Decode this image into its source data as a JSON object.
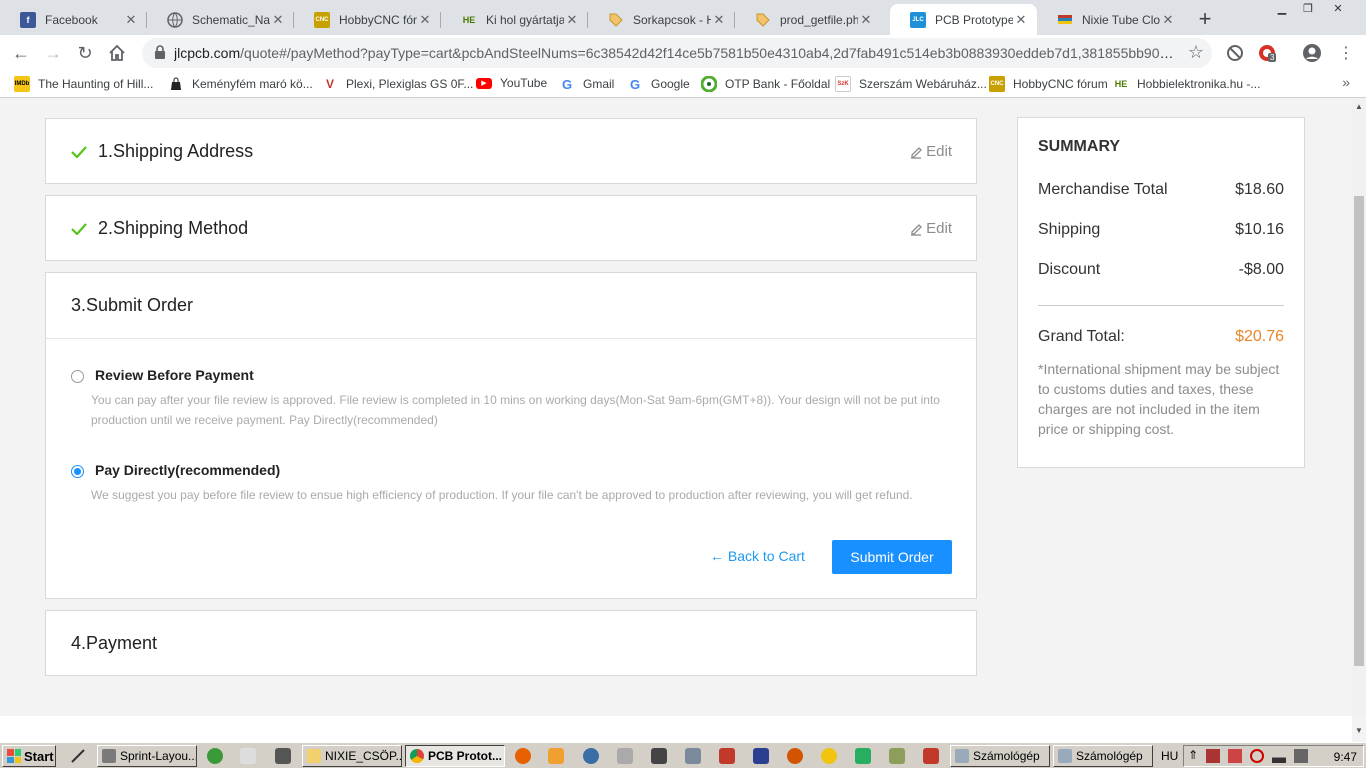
{
  "browser": {
    "tabs": [
      {
        "title": "Facebook",
        "icon": "facebook-icon",
        "color": "#3b5998",
        "glyph": "f"
      },
      {
        "title": "Schematic_Nano",
        "icon": "globe-icon",
        "color": "#5f6368",
        "glyph": ""
      },
      {
        "title": "HobbyCNC fórum",
        "icon": "cnc-icon",
        "color": "#c8a000",
        "glyph": "CNC"
      },
      {
        "title": "Ki hol gyártatja a",
        "icon": "he-icon",
        "color": "#4a7a00",
        "glyph": "HE"
      },
      {
        "title": "Sorkapcsok - HE",
        "icon": "tag-icon",
        "color": "#e8b04a",
        "glyph": ""
      },
      {
        "title": "prod_getfile.php",
        "icon": "tag-icon",
        "color": "#e8b04a",
        "glyph": ""
      },
      {
        "title": "PCB Prototype &",
        "icon": "jlc-icon",
        "color": "#1e90d8",
        "glyph": "JLC"
      },
      {
        "title": "Nixie Tube Clock",
        "icon": "tube-icon",
        "color": "#333333",
        "glyph": ""
      }
    ],
    "url_host": "jlcpcb.com",
    "url_rest": "/quote#/payMethod?payType=cart&pcbAndSteelNums=6c38542d42f14ce5b7581b50e4310ab4,2d7fab491c514eb3b0883930eddeb7d1,381855bb90b...",
    "extension_badge": "3"
  },
  "bookmarks": [
    {
      "label": "The Haunting of Hill...",
      "icon": "imdb-icon",
      "color": "#f5c518",
      "glyph": "IMDb"
    },
    {
      "label": "Keményfém maró kö...",
      "icon": "bag-icon",
      "color": "#222222",
      "glyph": ""
    },
    {
      "label": "Plexi, Plexiglas GS 0F...",
      "icon": "plexi-icon",
      "color": "#c0392b",
      "glyph": "V"
    },
    {
      "label": "YouTube",
      "icon": "youtube-icon",
      "color": "#ff0000",
      "glyph": "▶"
    },
    {
      "label": "Gmail",
      "icon": "google-icon",
      "color": "#4285f4",
      "glyph": "G"
    },
    {
      "label": "Google",
      "icon": "google-icon",
      "color": "#4285f4",
      "glyph": "G"
    },
    {
      "label": "OTP Bank - Főoldal",
      "icon": "otp-icon",
      "color": "#52ae30",
      "glyph": "C"
    },
    {
      "label": "Szerszám Webáruház...",
      "icon": "szerszam-icon",
      "color": "#d33",
      "glyph": "SzK"
    },
    {
      "label": "HobbyCNC fórum",
      "icon": "cnc-icon",
      "color": "#c8a000",
      "glyph": "CNC"
    },
    {
      "label": "Hobbielektronika.hu -...",
      "icon": "he-icon",
      "color": "#4a7a00",
      "glyph": "HE"
    }
  ],
  "checkout": {
    "step1": {
      "title": "1.Shipping Address",
      "edit": "Edit"
    },
    "step2": {
      "title": "2.Shipping Method",
      "edit": "Edit"
    },
    "step3": {
      "title": "3.Submit Order",
      "review": {
        "title": "Review Before Payment",
        "desc": "You can pay after your file review is approved. File review is completed in 10 mins on working days(Mon-Sat 9am-6pm(GMT+8)). Your design will not be put into production until we receive payment. Pay Directly(recommended)",
        "selected": false
      },
      "direct": {
        "title": "Pay Directly(recommended)",
        "desc": "We suggest you pay before file review to ensue high efficiency of production. If your file can't be approved to production after reviewing, you will get refund.",
        "selected": true
      },
      "back": "← Back to Cart",
      "submit": "Submit Order"
    },
    "step4": {
      "title": "4.Payment"
    }
  },
  "summary": {
    "title": "SUMMARY",
    "merch_label": "Merchandise Total",
    "merch_value": "$18.60",
    "ship_label": "Shipping",
    "ship_value": "$10.16",
    "disc_label": "Discount",
    "disc_value": "-$8.00",
    "grand_label": "Grand Total:",
    "grand_value": "$20.76",
    "note": "*International shipment may be subject to customs duties and taxes, these charges are not included in the item price or shipping cost."
  },
  "taskbar": {
    "start": "Start",
    "tasks": [
      {
        "label": "Sprint-Layou...",
        "icon": "sprint-icon",
        "pressed": false
      },
      {
        "label": "NIXIE_CSÖP...",
        "icon": "folder-icon",
        "pressed": false
      },
      {
        "label": "PCB Protot...",
        "icon": "chrome-icon",
        "pressed": true
      },
      {
        "label": "Számológép",
        "icon": "calculator-icon",
        "pressed": false
      },
      {
        "label": "Számológép",
        "icon": "calculator-icon",
        "pressed": false
      }
    ],
    "lang": "HU",
    "clock": "9:47"
  },
  "colors": {
    "accent": "#1890ff",
    "check": "#52c41a",
    "grand_total": "#e8862a"
  }
}
